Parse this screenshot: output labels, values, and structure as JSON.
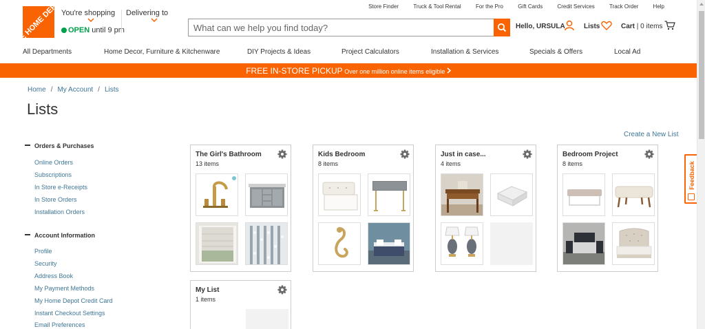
{
  "header": {
    "logo_text": "THE HOME DEPOT",
    "store": {
      "label": "You're shopping",
      "open": "OPEN",
      "until": " until 9 pm"
    },
    "delivering": {
      "label": "Delivering to"
    },
    "utility_links": [
      "Store Finder",
      "Truck & Tool Rental",
      "For the Pro",
      "Gift Cards",
      "Credit Services",
      "Track Order",
      "Help"
    ],
    "search": {
      "placeholder": "What can we help you find today?"
    },
    "account": {
      "greeting": "Hello, URSULA"
    },
    "lists": {
      "label": "Lists"
    },
    "cart": {
      "label": "Cart",
      "count": " | 0 items"
    }
  },
  "nav": {
    "items": [
      "All Departments",
      "Home Decor, Furniture & Kitchenware",
      "DIY Projects & Ideas",
      "Project Calculators",
      "Installation & Services",
      "Specials & Offers",
      "Local Ad"
    ]
  },
  "banner": {
    "title": "FREE IN-STORE PICKUP",
    "subtitle": " Over one million online items eligible "
  },
  "breadcrumb": [
    "Home",
    "My Account",
    "Lists"
  ],
  "page": {
    "title": "Lists",
    "create_link": "Create a New List"
  },
  "feedback": {
    "label": "Feedback"
  },
  "sidebar": {
    "sections": [
      {
        "title": "Orders & Purchases",
        "items": [
          "Online Orders",
          "Subscriptions",
          "In Store e-Receipts",
          "In Store Orders",
          "Installation Orders"
        ]
      },
      {
        "title": "Account Information",
        "items": [
          "Profile",
          "Security",
          "Address Book",
          "My Payment Methods",
          "My Home Depot Credit Card",
          "Instant Checkout Settings",
          "Email Preferences"
        ]
      }
    ]
  },
  "lists": [
    {
      "name": "The Girl's Bathroom",
      "count": "13 items",
      "thumbs": [
        "faucet-icon",
        "vanity-icon",
        "window-shade-icon",
        "shower-curtain-icon"
      ]
    },
    {
      "name": "Kids Bedroom",
      "count": "8 items",
      "thumbs": [
        "storage-bench-icon",
        "console-table-icon",
        "wall-hook-icon",
        "bedroom-photo-icon"
      ]
    },
    {
      "name": "Just in case...",
      "count": "4 items",
      "thumbs": [
        "desk-icon",
        "box-icon",
        "table-lamps-icon",
        ""
      ]
    },
    {
      "name": "Bedroom Project",
      "count": "8 items",
      "thumbs": [
        "bench-icon",
        "upholstered-bench-icon",
        "bedroom-set-icon",
        "tufted-bed-icon"
      ]
    },
    {
      "name": "My List",
      "count": "1 items",
      "thumbs": []
    }
  ],
  "colors": {
    "brand": "#f96302",
    "link": "#3e7697",
    "open": "#00a14b"
  }
}
